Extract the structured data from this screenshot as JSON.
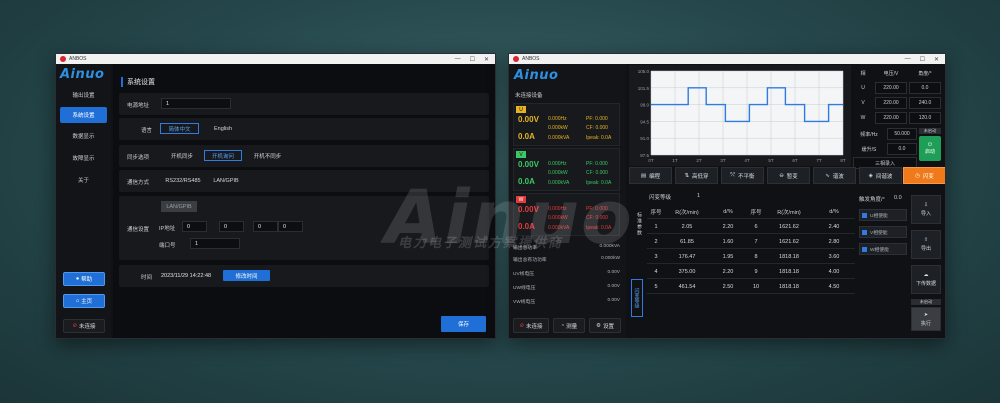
{
  "watermark": {
    "main": "Ainuo",
    "sub": "电力电子测试方案提供商"
  },
  "settings_window": {
    "title": "ANBOS",
    "window_controls": [
      "—",
      "☐",
      "✕"
    ],
    "brand": "Ainuo",
    "nav": [
      "输出设置",
      "系统设置",
      "数据显示",
      "故障显示",
      "关于"
    ],
    "nav_active_index": 1,
    "bottom_buttons": {
      "help": "帮助",
      "home": "主页",
      "disconnected": "未连接"
    },
    "section_title": "系统设置",
    "power_address": {
      "label": "电源地址",
      "value": "1"
    },
    "language": {
      "label": "语言",
      "options": [
        "简体中文",
        "English"
      ],
      "selected_index": 0
    },
    "sync": {
      "label": "同步选项",
      "options": [
        "开机同步",
        "开机询问",
        "开机不同步"
      ],
      "selected_index": 1
    },
    "comm_mode": {
      "label": "通信方式",
      "options": [
        "RS232/RS485",
        "LAN/GPIB"
      ]
    },
    "comm_settings": {
      "label": "通信设置",
      "lan_gpib": "LAN/GPIB",
      "ip_label": "IP地址",
      "ip": [
        "0",
        "0",
        "0",
        "0"
      ],
      "port_label": "端口号",
      "port": "1"
    },
    "time": {
      "label": "时间",
      "value": "2023/11/29 14:22:48",
      "button": "修改时间"
    },
    "save": "保存"
  },
  "main_window": {
    "title": "ANBOS",
    "window_controls": [
      "—",
      "☐",
      "✕"
    ],
    "brand": "Ainuo",
    "status": "未连接设备",
    "phases": [
      {
        "tag": "U",
        "color": "#e6b422",
        "v": "0.00V",
        "a": "0.0A",
        "hz": "0.000Hz",
        "kw": "0.000kW",
        "kva": "0.000kVA",
        "pf": "PF: 0.000",
        "cf": "CF: 0.000",
        "ipeak": "Ipeak: 0.0A"
      },
      {
        "tag": "V",
        "color": "#3cc864",
        "v": "0.00V",
        "a": "0.0A",
        "hz": "0.000Hz",
        "kw": "0.000kW",
        "kva": "0.000kVA",
        "pf": "PF: 0.000",
        "cf": "CF: 0.000",
        "ipeak": "Ipeak: 0.0A"
      },
      {
        "tag": "W",
        "color": "#e23b3b",
        "v": "0.00V",
        "a": "0.0A",
        "hz": "0.000Hz",
        "kw": "0.000kW",
        "kva": "0.000kVA",
        "pf": "PF: 0.000",
        "cf": "CF: 0.000",
        "ipeak": "Ipeak: 0.0A"
      }
    ],
    "measurements": [
      {
        "label": "输出总功率",
        "value": "0.000kVA"
      },
      {
        "label": "输出总有功功率",
        "value": "0.000kW"
      },
      {
        "label": "UV线电压",
        "value": "0.00V"
      },
      {
        "label": "UW线电压",
        "value": "0.00V"
      },
      {
        "label": "VW线电压",
        "value": "0.00V"
      }
    ],
    "bottom_buttons": {
      "disconnected": "未连接",
      "measure": "测量",
      "settings": "设置"
    },
    "chart_data": {
      "type": "line",
      "y_ticks": [
        "105.0",
        "101.5",
        "98.0",
        "94.5",
        "91.0",
        "87.5"
      ],
      "x_ticks": [
        "0T",
        "1T",
        "2T",
        "3T",
        "4T",
        "5T",
        "6T",
        "7T",
        "8T"
      ],
      "ylim": [
        87.5,
        105.0
      ],
      "xlim": [
        0,
        8
      ],
      "series": [
        {
          "points": [
            [
              0,
              98
            ],
            [
              1.55,
              98
            ],
            [
              1.55,
              101.5
            ],
            [
              2.3,
              101.5
            ],
            [
              2.3,
              98
            ],
            [
              3.1,
              98
            ],
            [
              3.1,
              94.5
            ],
            [
              4.1,
              94.5
            ],
            [
              4.1,
              98
            ],
            [
              4.85,
              98
            ],
            [
              4.85,
              101.5
            ],
            [
              5.6,
              101.5
            ],
            [
              5.6,
              98
            ],
            [
              6.4,
              98
            ],
            [
              6.4,
              94.5
            ],
            [
              7.4,
              94.5
            ],
            [
              7.4,
              98
            ],
            [
              8,
              98
            ]
          ]
        }
      ]
    },
    "phase_table": {
      "headers": [
        "相",
        "电压/V",
        "角度/°"
      ],
      "rows": [
        [
          "U",
          "220.00",
          "0.0"
        ],
        [
          "V",
          "220.00",
          "240.0"
        ],
        [
          "W",
          "220.00",
          "120.0"
        ]
      ],
      "freq_label": "频率/Hz",
      "freq": "50.000",
      "ramp_label": "缓升/S",
      "ramp": "0.0",
      "three_phase_input": "三相录入",
      "run_label": "未启动",
      "run_button": "启动"
    },
    "tools": [
      "编程",
      "高低穿",
      "不平衡",
      "暂变",
      "谐波",
      "间谐波",
      "闪变"
    ],
    "tools_active_index": 6,
    "flicker": {
      "level_label": "闪变等级",
      "level": "1",
      "side_label": "标准参数",
      "side_tab": "闪变等级",
      "headers": [
        "序号",
        "R(次/min)",
        "d/%",
        "序号",
        "R(次/min)",
        "d/%"
      ],
      "rows": [
        [
          "1",
          "2.05",
          "2.20",
          "6",
          "1621.62",
          "2.40"
        ],
        [
          "2",
          "61.85",
          "1.60",
          "7",
          "1621.62",
          "2.80"
        ],
        [
          "3",
          "176.47",
          "1.95",
          "8",
          "1818.18",
          "3.60"
        ],
        [
          "4",
          "375.00",
          "2.20",
          "9",
          "1818.18",
          "4.00"
        ],
        [
          "5",
          "461.54",
          "2.50",
          "10",
          "1818.18",
          "4.50"
        ]
      ]
    },
    "trigger": {
      "label": "触发角度/°",
      "value": "0.0"
    },
    "phase_checks": [
      "U相使能",
      "V相使能",
      "W相使能"
    ],
    "right_buttons": {
      "import": "导入",
      "export": "导出",
      "download": "下传数据",
      "status": "未启动",
      "execute": "执行"
    }
  }
}
